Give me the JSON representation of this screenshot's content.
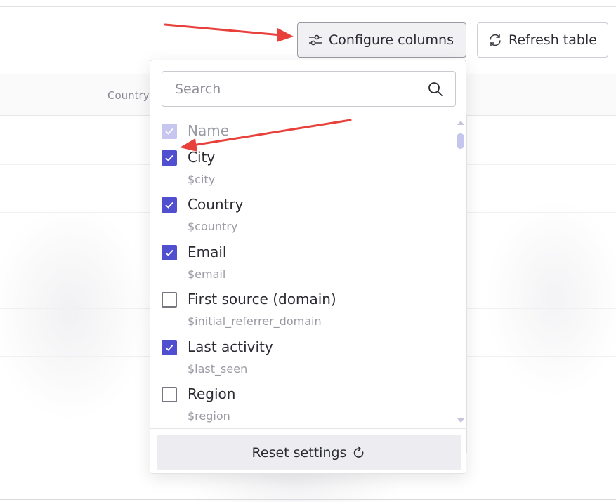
{
  "toolbar": {
    "configure_label": "Configure columns",
    "refresh_label": "Refresh table"
  },
  "table": {
    "header_country": "Country"
  },
  "column_picker": {
    "search_placeholder": "Search",
    "items": [
      {
        "label": "Name",
        "key": "",
        "checked": true,
        "disabled": true
      },
      {
        "label": "City",
        "key": "$city",
        "checked": true,
        "disabled": false
      },
      {
        "label": "Country",
        "key": "$country",
        "checked": true,
        "disabled": false
      },
      {
        "label": "Email",
        "key": "$email",
        "checked": true,
        "disabled": false
      },
      {
        "label": "First source (domain)",
        "key": "$initial_referrer_domain",
        "checked": false,
        "disabled": false
      },
      {
        "label": "Last activity",
        "key": "$last_seen",
        "checked": true,
        "disabled": false
      },
      {
        "label": "Region",
        "key": "$region",
        "checked": false,
        "disabled": false
      }
    ],
    "reset_label": "Reset settings"
  },
  "colors": {
    "accent": "#4f4fcf",
    "accent_disabled": "#c6c6ef",
    "annotation_arrow": "#e8403a"
  },
  "icons": {
    "configure": "sliders-icon",
    "refresh": "refresh-icon",
    "search": "search-icon",
    "reset": "rotate-icon",
    "checkbox": "check-icon"
  }
}
